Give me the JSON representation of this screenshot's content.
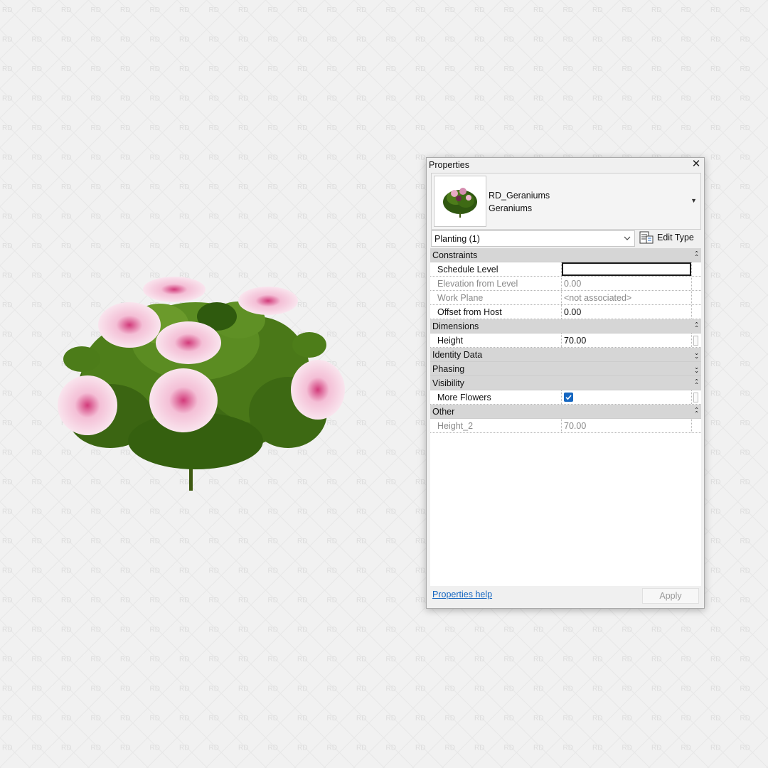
{
  "watermark": {
    "text": "RD"
  },
  "properties_panel": {
    "title": "Properties",
    "type_selector": {
      "family": "RD_Geraniums",
      "type": "Geraniums"
    },
    "filter": {
      "selected": "Planting (1)"
    },
    "edit_type_label": "Edit Type",
    "groups": {
      "constraints": {
        "label": "Constraints",
        "props": {
          "schedule_level": {
            "name": "Schedule Level",
            "value": ""
          },
          "elevation_from_level": {
            "name": "Elevation from Level",
            "value": "0.00"
          },
          "work_plane": {
            "name": "Work Plane",
            "value": "<not associated>"
          },
          "offset_from_host": {
            "name": "Offset from Host",
            "value": "0.00"
          }
        }
      },
      "dimensions": {
        "label": "Dimensions",
        "props": {
          "height": {
            "name": "Height",
            "value": "70.00"
          }
        }
      },
      "identity_data": {
        "label": "Identity Data"
      },
      "phasing": {
        "label": "Phasing"
      },
      "visibility": {
        "label": "Visibility",
        "props": {
          "more_flowers": {
            "name": "More Flowers",
            "checked": true
          }
        }
      },
      "other": {
        "label": "Other",
        "props": {
          "height_2": {
            "name": "Height_2",
            "value": "70.00"
          }
        }
      }
    },
    "help_link": "Properties help",
    "apply_label": "Apply"
  },
  "colors": {
    "background": "#f1f1f1",
    "link": "#1566c0",
    "checkbox": "#1667c1",
    "group_header": "#d6d6d6"
  }
}
